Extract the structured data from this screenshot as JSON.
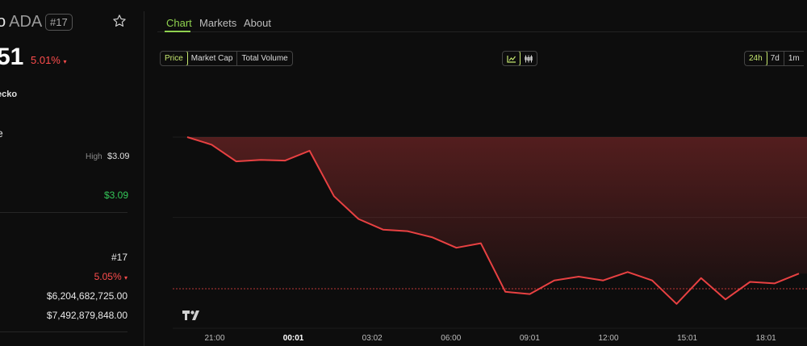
{
  "coin": {
    "name_fragment": "o",
    "symbol": "ADA",
    "rank_badge": "#17",
    "price_fragment": "51",
    "change_24h": "5.01%",
    "gecko_fragment": "ecko",
    "text_fragment": "e"
  },
  "range": {
    "high_label": "High",
    "high_value": "$3.09",
    "low_value": "$3.09"
  },
  "stats": [
    {
      "value": "#17",
      "color": "normal"
    },
    {
      "value": "5.05%",
      "color": "red",
      "arrow": "▾"
    },
    {
      "value": "$6,204,682,725.00",
      "color": "normal"
    },
    {
      "value": "$7,492,879,848.00",
      "color": "normal"
    }
  ],
  "tabs": [
    {
      "label": "Chart",
      "active": true
    },
    {
      "label": "Markets",
      "active": false
    },
    {
      "label": "About",
      "active": false
    }
  ],
  "metric_buttons": [
    {
      "label": "Price",
      "active": true
    },
    {
      "label": "Market Cap",
      "active": false
    },
    {
      "label": "Total Volume",
      "active": false
    }
  ],
  "chart_type_buttons": [
    {
      "icon": "line-chart-icon",
      "active": true
    },
    {
      "icon": "candlestick-icon",
      "active": false
    }
  ],
  "range_buttons": [
    {
      "label": "24h",
      "active": true
    },
    {
      "label": "7d",
      "active": false
    },
    {
      "label": "1m",
      "active": false
    }
  ],
  "colors": {
    "accent": "#8fd14f",
    "button_active": "#c6e86f",
    "down": "#ff4d4d",
    "up": "#34c759",
    "line": "#e84142"
  },
  "chart_data": {
    "type": "line",
    "x": [
      "20:30",
      "21:00",
      "21:30",
      "22:30",
      "23:30",
      "00:01",
      "01:00",
      "02:00",
      "03:02",
      "04:00",
      "05:00",
      "06:00",
      "07:00",
      "08:00",
      "09:01",
      "10:00",
      "11:00",
      "12:00",
      "13:00",
      "14:00",
      "15:01",
      "16:00",
      "17:00",
      "18:01",
      "19:00",
      "19:30"
    ],
    "values": [
      1.0,
      0.95,
      0.84,
      0.85,
      0.845,
      0.91,
      0.61,
      0.46,
      0.39,
      0.38,
      0.34,
      0.27,
      0.3,
      -0.02,
      -0.035,
      0.055,
      0.08,
      0.055,
      0.11,
      0.055,
      -0.1,
      0.07,
      -0.07,
      0.045,
      0.035,
      0.1
    ],
    "baseline": 0,
    "gridline": 0.47,
    "x_tick_labels": [
      "21:00",
      "00:01",
      "03:02",
      "06:00",
      "09:01",
      "12:00",
      "15:01",
      "18:01"
    ],
    "x_tick_bold": "00:01",
    "watermark": "TV"
  }
}
